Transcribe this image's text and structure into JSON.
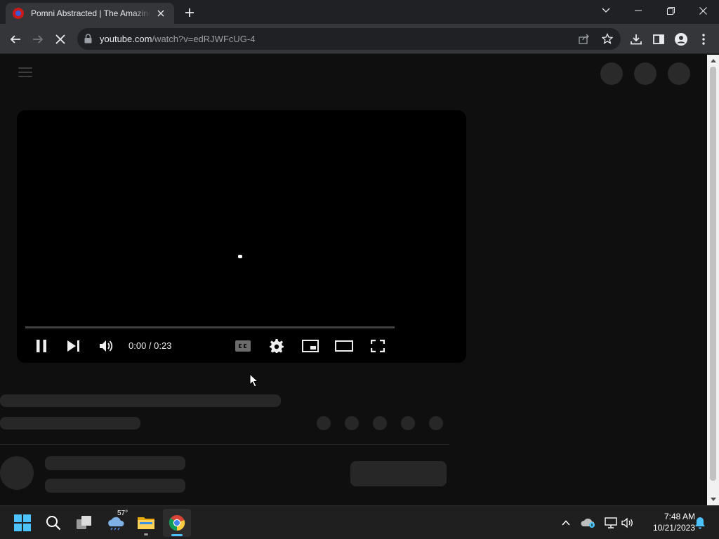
{
  "browser": {
    "tab": {
      "title": "Pomni Abstracted | The Amazing Digital Circus"
    },
    "address_bar": {
      "domain": "youtube.com",
      "path": "/watch?v=edRJWFcUG-4"
    }
  },
  "player": {
    "time_display": "0:00 / 0:23",
    "progress_fraction": 0.0
  },
  "taskbar": {
    "weather_temp": "57°",
    "clock_time": "7:48 AM",
    "clock_date": "10/21/2023"
  },
  "colors": {
    "page_bg": "#0f0f0f",
    "skeleton": "#272727",
    "chrome_toolbar": "#35363a",
    "chrome_titlebar": "#202124",
    "taskbar_accent": "#4cc2ff"
  }
}
